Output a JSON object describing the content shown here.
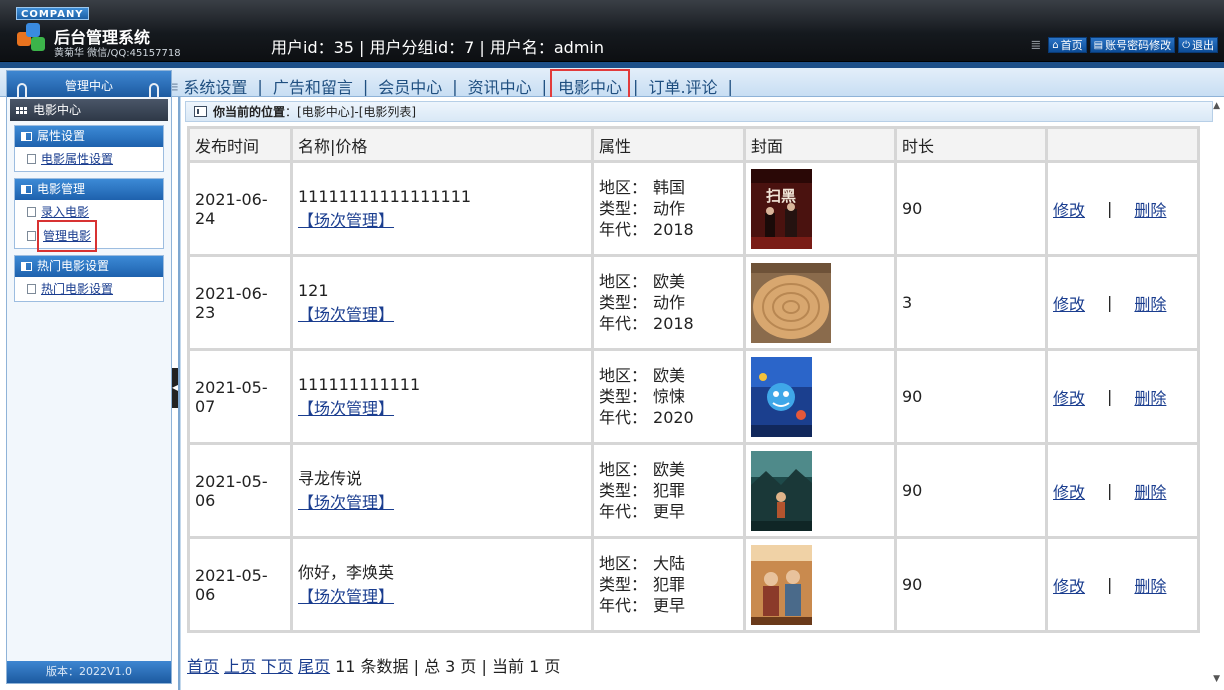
{
  "header": {
    "company": "COMPANY",
    "title": "后台管理系统",
    "subtitle": "黄菊华 微信/QQ:45157718",
    "user_info": "用户id：35 | 用户分组id：7 | 用户名：admin",
    "links": [
      {
        "icon": "home-icon",
        "label": "首页"
      },
      {
        "icon": "list-icon",
        "label": "账号密码修改"
      },
      {
        "icon": "power-icon",
        "label": "退出"
      }
    ]
  },
  "nav": {
    "items": [
      "系统设置",
      "广告和留言",
      "会员中心",
      "资讯中心",
      "电影中心",
      "订单.评论"
    ],
    "active": "电影中心"
  },
  "sidebar": {
    "head": "管理中心",
    "current": "电影中心",
    "groups": [
      {
        "title": "属性设置",
        "items": [
          "电影属性设置"
        ]
      },
      {
        "title": "电影管理",
        "items": [
          "录入电影",
          "管理电影"
        ]
      },
      {
        "title": "热门电影设置",
        "items": [
          "热门电影设置"
        ]
      }
    ],
    "active_item": "管理电影",
    "version": "版本：2022V1.0"
  },
  "breadcrumb": {
    "label": "你当前的位置",
    "path": "：[电影中心]-[电影列表]"
  },
  "table": {
    "headers": [
      "发布时间",
      "名称|价格",
      "属性",
      "封面",
      "时长",
      ""
    ],
    "attr_labels": {
      "region": "地区：",
      "type": "类型：",
      "year": "年代："
    },
    "schedule_label": "【场次管理】",
    "edit_label": "修改",
    "separator": "|",
    "delete_label": "删除",
    "rows": [
      {
        "date": "2021-06-24",
        "name": "11111111111111111",
        "region": "韩国",
        "type": "动作",
        "year": "2018",
        "cover": "poster-dark-red",
        "duration": "90"
      },
      {
        "date": "2021-06-23",
        "name": "121",
        "region": "欧美",
        "type": "动作",
        "year": "2018",
        "cover": "wood-slice",
        "duration": "3"
      },
      {
        "date": "2021-05-07",
        "name": "111111111111",
        "region": "欧美",
        "type": "惊悚",
        "year": "2020",
        "cover": "poster-blue-cartoon",
        "duration": "90"
      },
      {
        "date": "2021-05-06",
        "name": "寻龙传说",
        "region": "欧美",
        "type": "犯罪",
        "year": "更早",
        "cover": "poster-teal-forest",
        "duration": "90"
      },
      {
        "date": "2021-05-06",
        "name": "你好，李焕英",
        "region": "大陆",
        "type": "犯罪",
        "year": "更早",
        "cover": "poster-warm-family",
        "duration": "90"
      }
    ]
  },
  "pager": {
    "first": "首页",
    "prev": "上页",
    "next": "下页",
    "last": "尾页",
    "summary": "11 条数据 | 总 3 页 | 当前 1 页"
  }
}
